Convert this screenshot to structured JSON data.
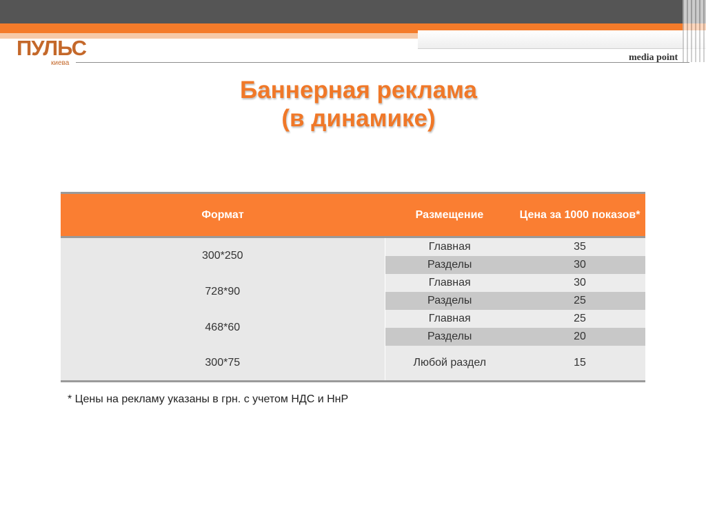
{
  "logo": {
    "main": "ПУЛЬС",
    "sub": "киева"
  },
  "brand": "media point",
  "title": {
    "line1": "Баннерная реклама",
    "line2": "(в динамике)"
  },
  "table": {
    "headers": {
      "format": "Формат",
      "placement": "Размещение",
      "price": "Цена за 1000 показов*"
    },
    "rows": [
      {
        "format": "300*250",
        "placement": "Главная",
        "price": "35"
      },
      {
        "placement": "Разделы",
        "price": "30"
      },
      {
        "format": "728*90",
        "placement": "Главная",
        "price": "30"
      },
      {
        "placement": "Разделы",
        "price": "25"
      },
      {
        "format": "468*60",
        "placement": "Главная",
        "price": "25"
      },
      {
        "placement": "Разделы",
        "price": "20"
      },
      {
        "format": "300*75",
        "placement": "Любой раздел",
        "price": "15"
      }
    ]
  },
  "footnote": "* Цены на рекламу указаны в грн. с учетом НДС и НнР",
  "colors": {
    "accent": "#f47b2a",
    "header_bar": "#555555",
    "table_header": "#fa7e32"
  }
}
